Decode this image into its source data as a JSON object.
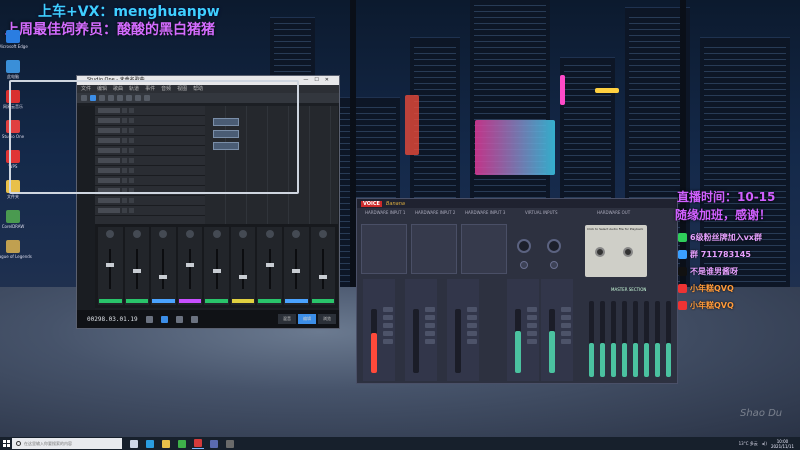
{
  "overlay": {
    "line1": "上车+VX：menghuanpw",
    "line2": "上周最佳饲养员：酸酸的黑白猪猪",
    "stream_time": "直播时间：10-15",
    "stream_sub": "随缘加班，感谢！",
    "social": [
      {
        "icon": "wechat-icon",
        "text": "6级粉丝牌加入vx群",
        "color": "#2fcf5a"
      },
      {
        "icon": "qq-icon",
        "text": "群 711783145",
        "color": "#3aa0ff"
      },
      {
        "icon": "tiktok-icon",
        "text": "不是谁男酱呀",
        "color": "#111111"
      },
      {
        "icon": "weibo-icon",
        "text": "小年糕QVQ",
        "color": "#e33",
        "orange": true
      },
      {
        "icon": "bilibili-icon",
        "text": "小年糕QVQ",
        "color": "#e33",
        "orange": true
      }
    ]
  },
  "daw": {
    "title": "Studio One - 未命名歌曲",
    "menu": [
      "文件",
      "编辑",
      "歌曲",
      "轨道",
      "事件",
      "音频",
      "视图",
      "帮助"
    ],
    "time": "00298.03.01.19",
    "tabs": [
      "混音",
      "编辑",
      "浏览"
    ],
    "track_colors": [
      "#29c46a",
      "#29c46a",
      "#4aa3ff",
      "#c84fff",
      "#29c46a",
      "#e0d040",
      "#29c46a",
      "#4aa3ff",
      "#29c46a"
    ]
  },
  "voicemeeter": {
    "logo": "VOICE",
    "logo2": "Banana",
    "inputs": [
      "HARDWARE INPUT 1",
      "HARDWARE INPUT 2",
      "HARDWARE INPUT 3",
      "VIRTUAL INPUTS",
      "HARDWARE OUT"
    ],
    "cassette_text": "Click to Select Audio File for Playback",
    "master_label": "MASTER SECTION",
    "fader_colors": [
      "#ff4a3a",
      "#3b3f55",
      "#3b3f55",
      "#4bc2a0",
      "#4bc2a0"
    ],
    "fader_levels": [
      0.62,
      0.0,
      0.0,
      0.65,
      0.65
    ],
    "master_levels": [
      0.45,
      0.45,
      0.45,
      0.45,
      0.45,
      0.45,
      0.45,
      0.45
    ]
  },
  "desktop": {
    "icons": [
      {
        "label": "Microsoft Edge",
        "color": "#2a7de1"
      },
      {
        "label": "此电脑",
        "color": "#3a8fd8"
      },
      {
        "label": "网易云音乐",
        "color": "#d93030"
      },
      {
        "label": "Studio One",
        "color": "#e04040"
      },
      {
        "label": "WPS",
        "color": "#e03535"
      },
      {
        "label": "文件夹",
        "color": "#e8c04a"
      },
      {
        "label": "CorelDRAW",
        "color": "#4a9a50"
      },
      {
        "label": "League of Legends",
        "color": "#c0a050"
      }
    ]
  },
  "taskbar": {
    "search_placeholder": "在这里输入你要搜索的内容",
    "apps": [
      {
        "icon": "task-view-icon",
        "color": "#cfd8e8"
      },
      {
        "icon": "edge-icon",
        "color": "#2a9de1"
      },
      {
        "icon": "explorer-icon",
        "color": "#e8c04a"
      },
      {
        "icon": "chrome-icon",
        "color": "#3fb04a"
      },
      {
        "icon": "studio-one-icon",
        "color": "#d43a3a"
      },
      {
        "icon": "voicemeeter-icon",
        "color": "#5a6ab0"
      },
      {
        "icon": "obs-icon",
        "color": "#6a6a6a"
      }
    ],
    "weather": "13°C 多云",
    "time": "10:00",
    "date": "2021/11/11"
  },
  "watermark": "Shao Du"
}
